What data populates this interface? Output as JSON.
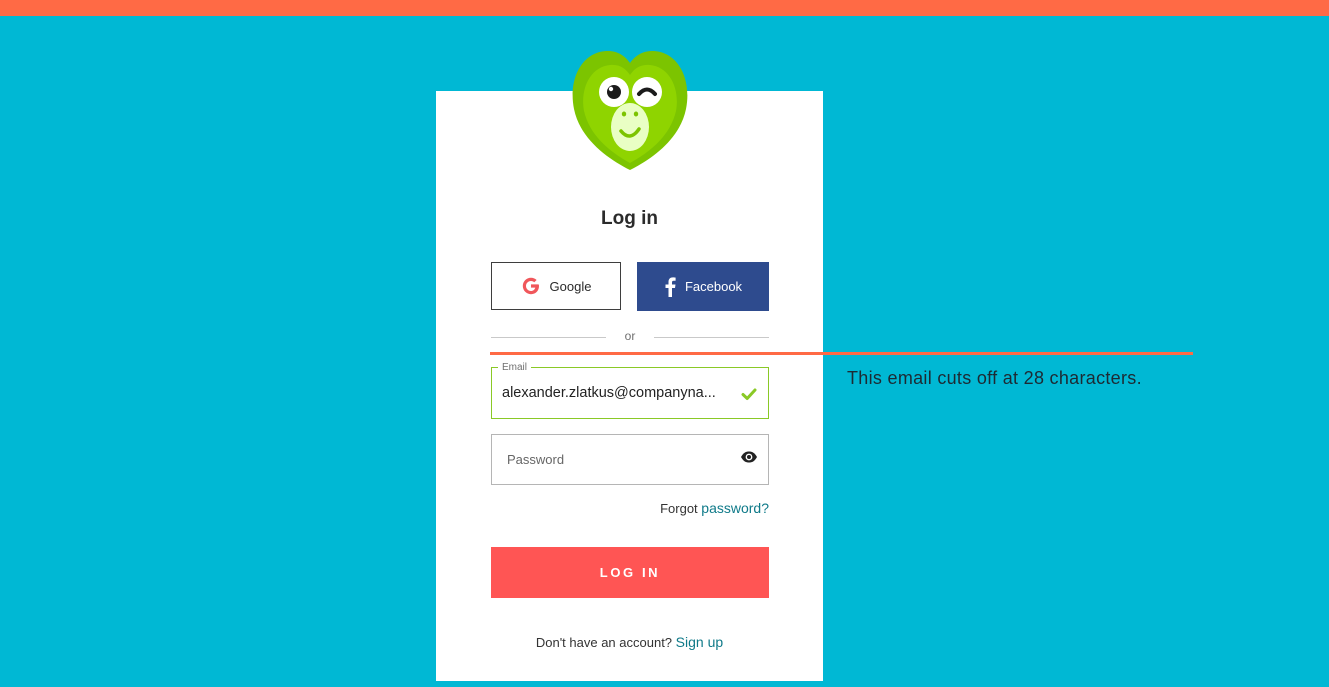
{
  "colors": {
    "background": "#00b8d4",
    "top_bar": "#ff6a45",
    "facebook": "#2e4b8e",
    "login_button": "#ff5554",
    "link": "#0f7a89",
    "valid_green": "#8ac926"
  },
  "logo": {
    "icon": "monkey-logo-icon"
  },
  "login": {
    "title": "Log in",
    "google_label": "Google",
    "facebook_label": "Facebook",
    "divider": "or",
    "email_label": "Email",
    "email_value": "alexander.zlatkus@companyna...",
    "password_placeholder": "Password",
    "forgot_prefix": "Forgot",
    "forgot_link": "password?",
    "submit_label": "LOG IN",
    "signup_prefix": "Don't have an account?",
    "signup_link": "Sign up"
  },
  "annotation": {
    "text": "This email cuts off at 28 characters."
  }
}
